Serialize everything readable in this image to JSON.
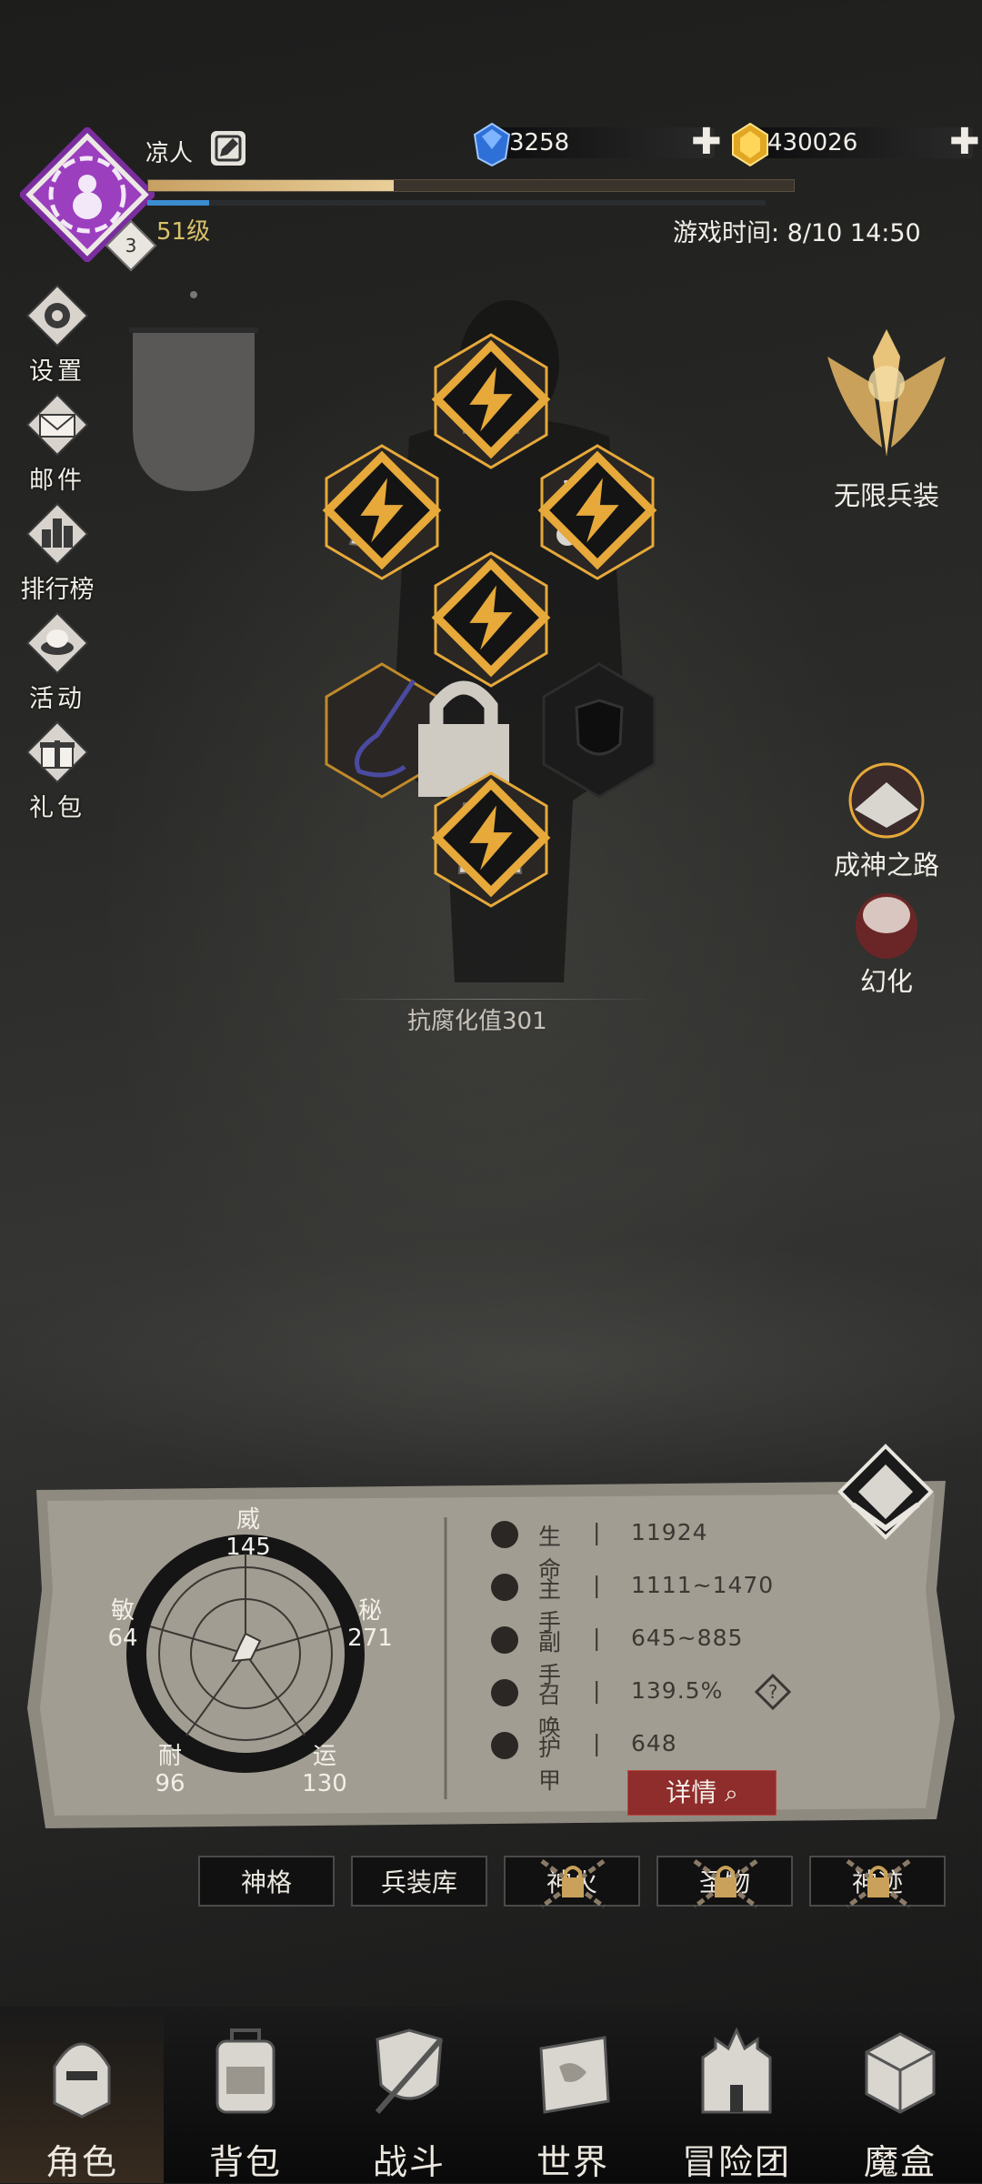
{
  "player": {
    "name": "凉人",
    "level_text": "51级",
    "avatar_badge": "3",
    "exp_progress": 0.38,
    "mana_progress": 0.1
  },
  "currency": {
    "gems": "3258",
    "gold": "430026"
  },
  "game_time": "游戏时间: 8/10 14:50",
  "side_menu": {
    "settings": "设置",
    "mail": "邮件",
    "ranking": "排行榜",
    "activity": "活动",
    "gift": "礼包"
  },
  "right_features": {
    "infinite_weapon": "无限兵装",
    "god_path": "成神之路",
    "transform": "幻化"
  },
  "corruption": "抗腐化值301",
  "attributes": [
    {
      "name": "威",
      "value": "145"
    },
    {
      "name": "秘",
      "value": "271"
    },
    {
      "name": "运",
      "value": "130"
    },
    {
      "name": "耐",
      "value": "96"
    },
    {
      "name": "敏",
      "value": "64"
    }
  ],
  "stats": [
    {
      "name": "生命",
      "value": "11924",
      "icon": "heart-icon"
    },
    {
      "name": "主手",
      "value": "1111~1470",
      "icon": "main-hand-icon"
    },
    {
      "name": "副手",
      "value": "645~885",
      "icon": "off-hand-icon"
    },
    {
      "name": "召唤",
      "value": "139.5%",
      "icon": "summon-icon"
    },
    {
      "name": "护甲",
      "value": "648",
      "icon": "armor-icon"
    }
  ],
  "stat_separator": "|",
  "details_label": "详情",
  "sub_tabs": [
    "神格",
    "兵装库",
    "神火",
    "圣物",
    "神迹"
  ],
  "bottom_nav": [
    "角色",
    "背包",
    "战斗",
    "世界",
    "冒险团",
    "魔盒"
  ],
  "colors": {
    "accent_gold": "#e6a93a",
    "level_text": "#d9c16a",
    "details_button": "#8e2d2b",
    "avatar_purple": "#9b3fbf"
  }
}
